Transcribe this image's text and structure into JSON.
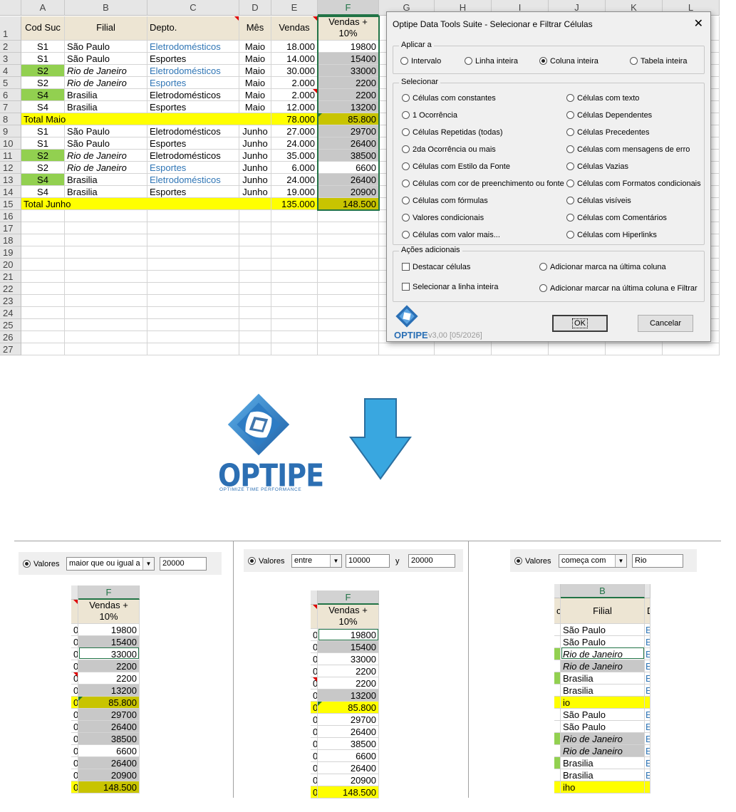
{
  "sheet": {
    "columns": [
      "A",
      "B",
      "C",
      "D",
      "E",
      "F",
      "G",
      "H",
      "I",
      "J",
      "K",
      "L"
    ],
    "rows": [
      "1",
      "2",
      "3",
      "4",
      "5",
      "6",
      "7",
      "8",
      "9",
      "10",
      "11",
      "12",
      "13",
      "14",
      "15",
      "16",
      "17",
      "18",
      "19",
      "20",
      "21",
      "22",
      "23",
      "24",
      "25",
      "26",
      "27"
    ],
    "headers": {
      "a": "Cod Suc",
      "b": "Filial",
      "c": "Depto.",
      "d": "Mês",
      "e": "Vendas",
      "f": "Vendas + 10%"
    },
    "data": [
      {
        "a": "S1",
        "b": "São Paulo",
        "c": "Eletrodomésticos",
        "d": "Maio",
        "e": "18.000",
        "f": "19800"
      },
      {
        "a": "S1",
        "b": "São Paulo",
        "c": "Esportes",
        "d": "Maio",
        "e": "14.000",
        "f": "15400"
      },
      {
        "a": "S2",
        "b": "Rio de Janeiro",
        "c": "Eletrodomésticos",
        "d": "Maio",
        "e": "30.000",
        "f": "33000"
      },
      {
        "a": "S2",
        "b": "Rio de Janeiro",
        "c": "Esportes",
        "d": "Maio",
        "e": "2.000",
        "f": "2200"
      },
      {
        "a": "S4",
        "b": "Brasilia",
        "c": "Eletrodomésticos",
        "d": "Maio",
        "e": "2.000",
        "f": "2200"
      },
      {
        "a": "S4",
        "b": "Brasilia",
        "c": "Esportes",
        "d": "Maio",
        "e": "12.000",
        "f": "13200"
      },
      {
        "a": "Total Maio",
        "b": "",
        "c": "",
        "d": "",
        "e": "78.000",
        "f": "85.800"
      },
      {
        "a": "S1",
        "b": "São Paulo",
        "c": "Eletrodomésticos",
        "d": "Junho",
        "e": "27.000",
        "f": "29700"
      },
      {
        "a": "S1",
        "b": "São Paulo",
        "c": "Esportes",
        "d": "Junho",
        "e": "24.000",
        "f": "26400"
      },
      {
        "a": "S2",
        "b": "Rio de Janeiro",
        "c": "Eletrodomésticos",
        "d": "Junho",
        "e": "35.000",
        "f": "38500"
      },
      {
        "a": "S2",
        "b": "Rio de Janeiro",
        "c": "Esportes",
        "d": "Junho",
        "e": "6.000",
        "f": "6600"
      },
      {
        "a": "S4",
        "b": "Brasilia",
        "c": "Eletrodomésticos",
        "d": "Junho",
        "e": "24.000",
        "f": "26400"
      },
      {
        "a": "S4",
        "b": "Brasilia",
        "c": "Esportes",
        "d": "Junho",
        "e": "19.000",
        "f": "20900"
      },
      {
        "a": "Total Junho",
        "b": "",
        "c": "",
        "d": "",
        "e": "135.000",
        "f": "148.500"
      }
    ]
  },
  "dialog": {
    "title": "Optipe Data Tools Suite - Selecionar e Filtrar Células",
    "close": "✕",
    "apply_label": "Aplicar a",
    "apply_options": [
      "Intervalo",
      "Linha inteira",
      "Coluna inteira",
      "Tabela inteira"
    ],
    "apply_selected": "Coluna inteira",
    "select_label": "Selecionar",
    "select_left": [
      "Células com constantes",
      "1 Ocorrência",
      "Células Repetidas (todas)",
      "2da Ocorrência ou mais",
      "Células com Estilo da Fonte",
      "Células com cor de preenchimento ou fonte",
      "Células com fórmulas",
      "Valores condicionais",
      "Células com valor mais..."
    ],
    "select_right": [
      "Células com texto",
      "Células Dependentes",
      "Células Precedentes",
      "Células com mensagens de erro",
      "Células Vazias",
      "Células com Formatos condicionais",
      "Células visíveis",
      "Células com Comentários",
      "Células com Hiperlinks"
    ],
    "actions_label": "Ações adicionais",
    "actions": {
      "highlight": "Destacar células",
      "select_row": "Selecionar a linha inteira",
      "mark_last": "Adicionar marca na última coluna",
      "mark_filter": "Adicionar marcar na última coluna e Filtrar"
    },
    "ok": "OK",
    "cancel": "Cancelar",
    "brand": "OPTIPE",
    "version": "v3,00 [05/2026]"
  },
  "logo": {
    "word": "OPTIPE",
    "tagline": "OPTIMIZE TIME PERFORMANCE"
  },
  "colors": {
    "accent": "#217346",
    "brand": "#2c6fb3",
    "arrow": "#39a7e0",
    "yellow": "#ffff00",
    "green": "#92d050",
    "gray": "#c8c8c8"
  },
  "panels": {
    "p1": {
      "radio_label": "Valores",
      "operator": "maior que ou igual a",
      "value": "20000",
      "col": "F",
      "header": "Vendas + 10%",
      "values": [
        "19800",
        "15400",
        "33000",
        "2200",
        "2200",
        "13200",
        "85.800",
        "29700",
        "26400",
        "38500",
        "6600",
        "26400",
        "20900",
        "148.500"
      ],
      "left": [
        "0",
        "0",
        "0",
        "0",
        "0",
        "0",
        "0",
        "0",
        "0",
        "0",
        "0",
        "0",
        "0",
        "0"
      ]
    },
    "p2": {
      "radio_label": "Valores",
      "operator": "entre",
      "value1": "10000",
      "sep": "y",
      "value2": "20000",
      "col": "F",
      "header": "Vendas + 10%",
      "values": [
        "19800",
        "15400",
        "33000",
        "2200",
        "2200",
        "13200",
        "85.800",
        "29700",
        "26400",
        "38500",
        "6600",
        "26400",
        "20900",
        "148.500"
      ],
      "left": [
        "0",
        "0",
        "0",
        "0",
        "0",
        "0",
        "0",
        "0",
        "0",
        "0",
        "0",
        "0",
        "0",
        "0"
      ]
    },
    "p3": {
      "radio_label": "Valores",
      "operator": "começa com",
      "value": "Rio",
      "col": "B",
      "header": "Filial",
      "left_hdr": "c",
      "right_hdr": "D",
      "values": [
        "São Paulo",
        "São Paulo",
        "Rio de Janeiro",
        "Rio de Janeiro",
        "Brasilia",
        "Brasilia",
        "io",
        "São Paulo",
        "São Paulo",
        "Rio de Janeiro",
        "Rio de Janeiro",
        "Brasilia",
        "Brasilia",
        "iho"
      ],
      "right": [
        "E",
        "E",
        "E",
        "E",
        "E",
        "E",
        "",
        "E",
        "E",
        "E",
        "E",
        "E",
        "E",
        ""
      ]
    }
  }
}
